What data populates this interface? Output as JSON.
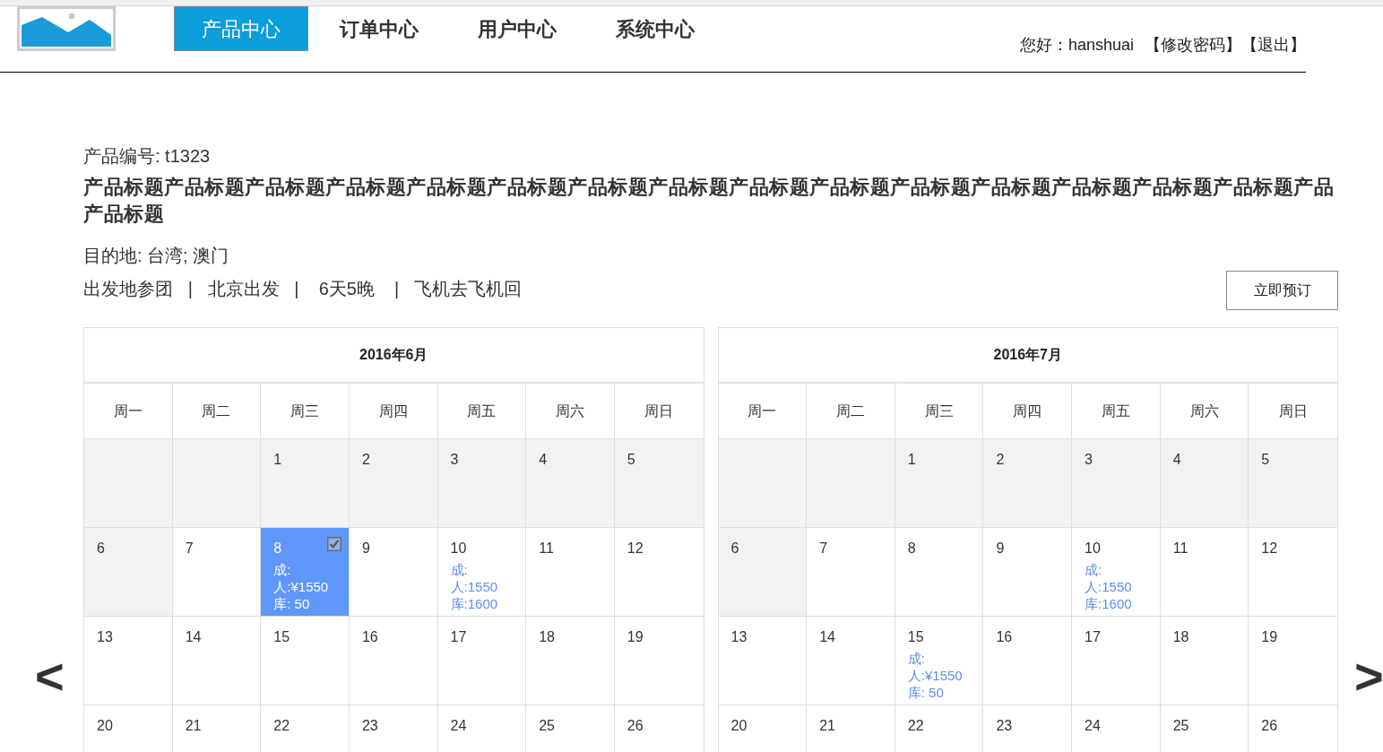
{
  "header": {
    "nav": [
      {
        "label": "产品中心",
        "selected": true
      },
      {
        "label": "订单中心",
        "selected": false
      },
      {
        "label": "用户中心",
        "selected": false
      },
      {
        "label": "系统中心",
        "selected": false
      }
    ],
    "greeting": "您好：hanshuai",
    "links": [
      "【修改密码】",
      "【退出】"
    ]
  },
  "product": {
    "number": "产品编号: t1323",
    "title": "产品标题产品标题产品标题产品标题产品标题产品标题产品标题产品标题产品标题产品标题产品标题产品标题产品标题产品标题产品标题产品产品标题",
    "destination": "目的地: 台湾; 澳门",
    "meta": "出发地参团   |   北京出发   |    6天5晚    |   飞机去飞机回",
    "book_button": "立即预订"
  },
  "calendar_nav": {
    "prev": "<",
    "next": ">"
  },
  "calendars": [
    {
      "title": "2016年6月",
      "weekdays": [
        "周一",
        "周二",
        "周三",
        "周四",
        "周五",
        "周六",
        "周日"
      ],
      "weeks": [
        [
          {
            "disabled": true,
            "selected": false
          },
          {
            "disabled": true,
            "selected": false
          },
          {
            "day": "1",
            "disabled": true,
            "selected": false
          },
          {
            "day": "2",
            "disabled": true,
            "selected": false
          },
          {
            "day": "3",
            "disabled": true,
            "selected": false
          },
          {
            "day": "4",
            "disabled": true,
            "selected": false
          },
          {
            "day": "5",
            "disabled": true,
            "selected": false
          }
        ],
        [
          {
            "day": "6",
            "disabled": true,
            "selected": false
          },
          {
            "day": "7",
            "disabled": false,
            "selected": false
          },
          {
            "day": "8",
            "disabled": false,
            "selected": true,
            "prices": [
              "成:",
              "人:¥1550",
              "库: 50"
            ]
          },
          {
            "day": "9",
            "disabled": false,
            "selected": false
          },
          {
            "day": "10",
            "disabled": false,
            "selected": false,
            "prices": [
              "成:",
              "人:1550",
              "库:1600"
            ]
          },
          {
            "day": "11",
            "disabled": false,
            "selected": false
          },
          {
            "day": "12",
            "disabled": false,
            "selected": false
          }
        ],
        [
          {
            "day": "13",
            "disabled": false,
            "selected": false
          },
          {
            "day": "14",
            "disabled": false,
            "selected": false
          },
          {
            "day": "15",
            "disabled": false,
            "selected": false
          },
          {
            "day": "16",
            "disabled": false,
            "selected": false
          },
          {
            "day": "17",
            "disabled": false,
            "selected": false
          },
          {
            "day": "18",
            "disabled": false,
            "selected": false
          },
          {
            "day": "19",
            "disabled": false,
            "selected": false
          }
        ],
        [
          {
            "day": "20",
            "disabled": false,
            "selected": false
          },
          {
            "day": "21",
            "disabled": false,
            "selected": false
          },
          {
            "day": "22",
            "disabled": false,
            "selected": false
          },
          {
            "day": "23",
            "disabled": false,
            "selected": false
          },
          {
            "day": "24",
            "disabled": false,
            "selected": false
          },
          {
            "day": "25",
            "disabled": false,
            "selected": false
          },
          {
            "day": "26",
            "disabled": false,
            "selected": false
          }
        ]
      ]
    },
    {
      "title": "2016年7月",
      "weekdays": [
        "周一",
        "周二",
        "周三",
        "周四",
        "周五",
        "周六",
        "周日"
      ],
      "weeks": [
        [
          {
            "disabled": true,
            "selected": false
          },
          {
            "disabled": true,
            "selected": false
          },
          {
            "day": "1",
            "disabled": true,
            "selected": false
          },
          {
            "day": "2",
            "disabled": true,
            "selected": false
          },
          {
            "day": "3",
            "disabled": true,
            "selected": false
          },
          {
            "day": "4",
            "disabled": true,
            "selected": false
          },
          {
            "day": "5",
            "disabled": true,
            "selected": false
          }
        ],
        [
          {
            "day": "6",
            "disabled": true,
            "selected": false
          },
          {
            "day": "7",
            "disabled": false,
            "selected": false
          },
          {
            "day": "8",
            "disabled": false,
            "selected": false
          },
          {
            "day": "9",
            "disabled": false,
            "selected": false
          },
          {
            "day": "10",
            "disabled": false,
            "selected": false,
            "prices": [
              "成:",
              "人:1550",
              "库:1600"
            ]
          },
          {
            "day": "11",
            "disabled": false,
            "selected": false
          },
          {
            "day": "12",
            "disabled": false,
            "selected": false
          }
        ],
        [
          {
            "day": "13",
            "disabled": false,
            "selected": false
          },
          {
            "day": "14",
            "disabled": false,
            "selected": false
          },
          {
            "day": "15",
            "disabled": false,
            "selected": false,
            "prices": [
              "成:",
              "人:¥1550",
              "库: 50"
            ]
          },
          {
            "day": "16",
            "disabled": false,
            "selected": false
          },
          {
            "day": "17",
            "disabled": false,
            "selected": false
          },
          {
            "day": "18",
            "disabled": false,
            "selected": false
          },
          {
            "day": "19",
            "disabled": false,
            "selected": false
          }
        ],
        [
          {
            "day": "20",
            "disabled": false,
            "selected": false
          },
          {
            "day": "21",
            "disabled": false,
            "selected": false
          },
          {
            "day": "22",
            "disabled": false,
            "selected": false
          },
          {
            "day": "23",
            "disabled": false,
            "selected": false
          },
          {
            "day": "24",
            "disabled": false,
            "selected": false
          },
          {
            "day": "25",
            "disabled": false,
            "selected": false
          },
          {
            "day": "26",
            "disabled": false,
            "selected": false
          }
        ]
      ]
    }
  ]
}
